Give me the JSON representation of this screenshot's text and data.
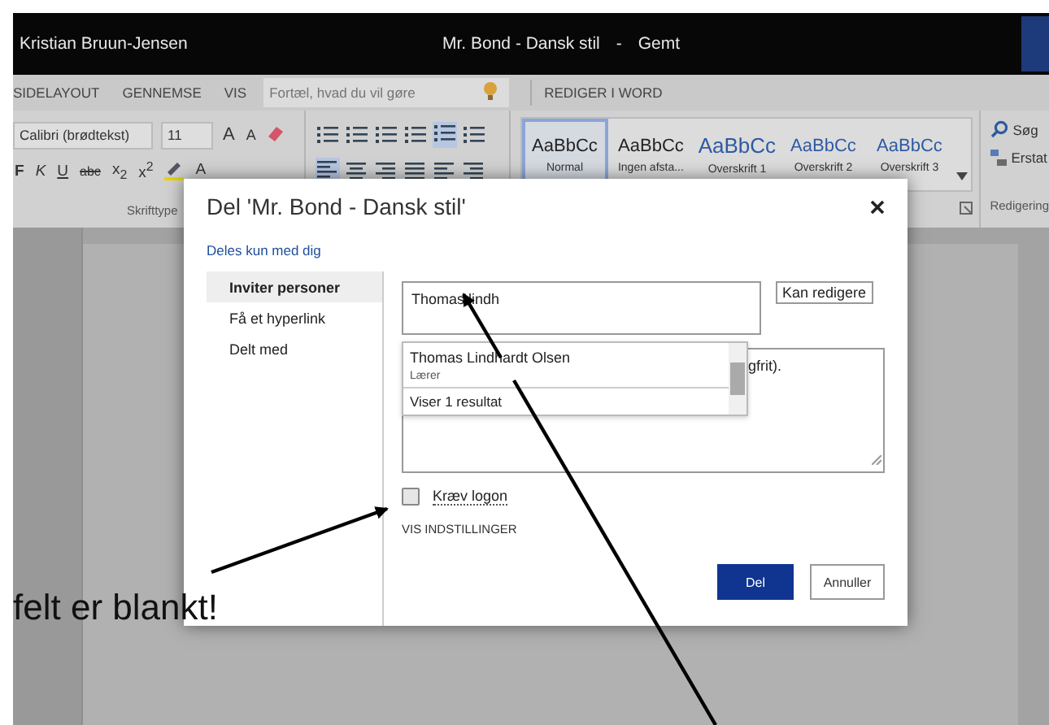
{
  "title_bar": {
    "user": "Kristian Bruun-Jensen",
    "document": "Mr. Bond - Dansk stil",
    "separator": "-",
    "status": "Gemt"
  },
  "ribbon_tabs": [
    {
      "label": "SIDELAYOUT"
    },
    {
      "label": "GENNEMSE"
    },
    {
      "label": "VIS"
    }
  ],
  "tell_me": {
    "placeholder": "Fortæl, hvad du vil gøre"
  },
  "edit_in_word": "REDIGER I WORD",
  "font": {
    "name": "Calibri (brødtekst)",
    "size": "11",
    "size_buttons": [
      "A",
      "A"
    ],
    "format_buttons": [
      "F",
      "K",
      "U",
      "abc",
      "x$_{2}$",
      "x$^{2}$"
    ],
    "color_button": "A"
  },
  "styles": [
    {
      "sample": "AaBbCc",
      "name": "Normal",
      "kind": "normal",
      "selected": true
    },
    {
      "sample": "AaBbCc",
      "name": "Ingen afsta...",
      "kind": "normal",
      "selected": false
    },
    {
      "sample": "AaBbCc",
      "name": "Overskrift 1",
      "kind": "heading1",
      "selected": false
    },
    {
      "sample": "AaBbCc",
      "name": "Overskrift 2",
      "kind": "heading2",
      "selected": false
    },
    {
      "sample": "AaBbCc",
      "name": "Overskrift 3",
      "kind": "heading3",
      "selected": false
    }
  ],
  "editing": {
    "find": "Søg",
    "replace": "Erstat"
  },
  "group_labels": {
    "font": "Skrifttype",
    "editing": "Redigering"
  },
  "dialog": {
    "title": "Del 'Mr. Bond - Dansk stil'",
    "shared_with": "Deles kun med dig",
    "nav": [
      {
        "label": "Inviter personer",
        "selected": true
      },
      {
        "label": "Få et hyperlink",
        "selected": false
      },
      {
        "label": "Delt med",
        "selected": false
      }
    ],
    "invite_field": {
      "value": "Thomas lindh"
    },
    "permission": {
      "value": "Kan redigere"
    },
    "message_fragment": "gfrit).",
    "suggestion": {
      "name": "Thomas Lindhardt Olsen",
      "role": "Lærer",
      "result_count": "Viser 1 resultat"
    },
    "require_logon": {
      "label": "Kræv logon",
      "checked": false
    },
    "options_link": "VIS INDSTILLINGER",
    "buttons": [
      {
        "label": "Del",
        "kind": "primary"
      },
      {
        "label": "Annuller",
        "kind": "secondary"
      }
    ]
  },
  "annotation": {
    "text": "felt er blankt!"
  }
}
